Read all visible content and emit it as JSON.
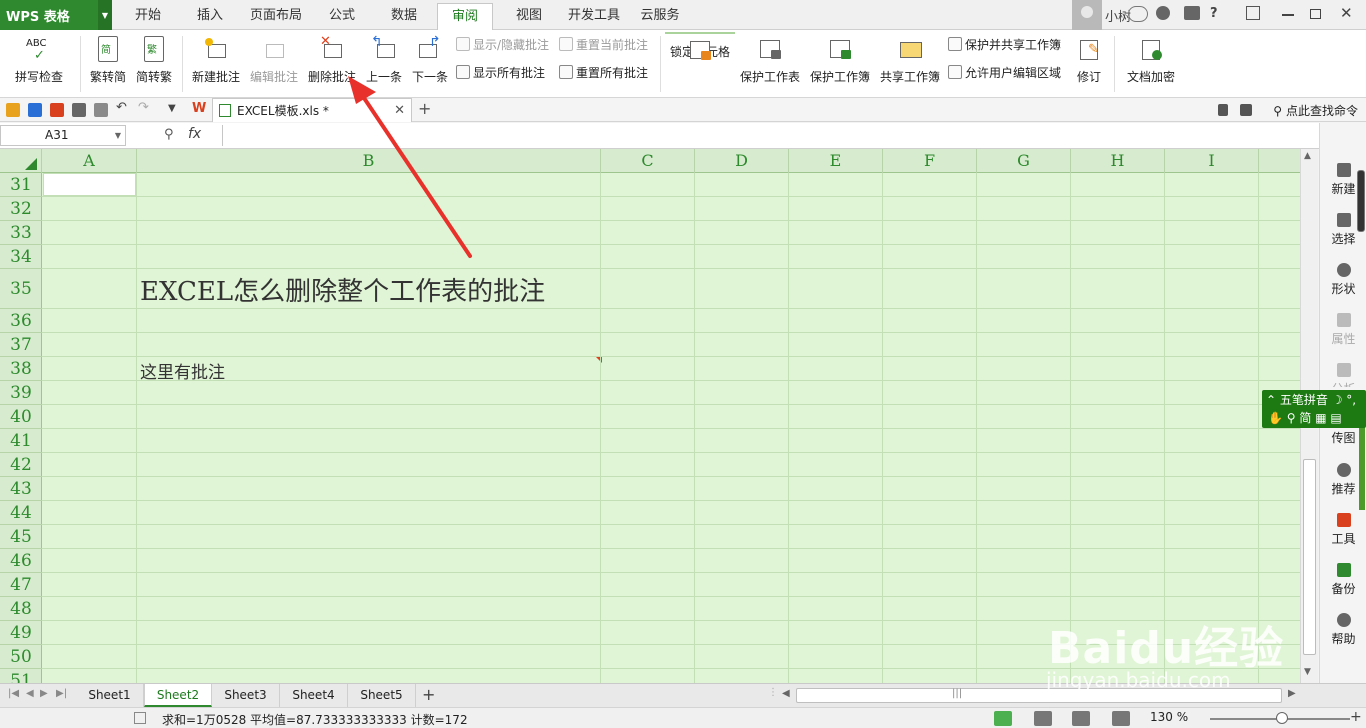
{
  "app": {
    "brand": "WPS 表格"
  },
  "menu_tabs": [
    "开始",
    "插入",
    "页面布局",
    "公式",
    "数据",
    "审阅",
    "视图",
    "开发工具",
    "云服务"
  ],
  "active_menu_tab": "审阅",
  "user": {
    "name": "小树",
    "help": "?"
  },
  "ribbon": {
    "spell_check": "拼写检查",
    "trad_to_simp": "繁转简",
    "simp_to_trad": "简转繁",
    "new_comment": "新建批注",
    "edit_comment": "编辑批注",
    "delete_comment": "删除批注",
    "previous": "上一条",
    "next": "下一条",
    "show_hide_comment": "显示/隐藏批注",
    "reset_current_comment": "重置当前批注",
    "show_all_comments": "显示所有批注",
    "reset_all_comments": "重置所有批注",
    "lock_cell": "锁定单元格",
    "protect_sheet": "保护工作表",
    "protect_workbook": "保护工作簿",
    "share_workbook": "共享工作簿",
    "protect_and_share": "保护并共享工作簿",
    "allow_user_edit": "允许用户编辑区域",
    "track_changes": "修订",
    "doc_encrypt": "文档加密",
    "icon_labels": {
      "abc": "ABC",
      "trad": "繁",
      "simp": "简"
    }
  },
  "document": {
    "tab_title": "EXCEL模板.xls *",
    "find_command": "点此查找命令"
  },
  "formula_bar": {
    "cell_ref": "A31",
    "fx": "fx",
    "value": ""
  },
  "grid": {
    "columns": [
      "A",
      "B",
      "C",
      "D",
      "E",
      "F",
      "G",
      "H",
      "I"
    ],
    "rows": [
      "31",
      "32",
      "33",
      "34",
      "35",
      "36",
      "37",
      "38",
      "39",
      "40",
      "41",
      "42",
      "43",
      "44",
      "45",
      "46",
      "47",
      "48",
      "49",
      "50",
      "51"
    ],
    "b35": "EXCEL怎么删除整个工作表的批注",
    "b38": "这里有批注"
  },
  "sidebar": {
    "items": [
      "新建",
      "选择",
      "形状",
      "属性",
      "分析",
      "传图",
      "推荐",
      "工具",
      "备份",
      "帮助"
    ]
  },
  "ime": {
    "line1": "五笔拼音",
    "line2": "简"
  },
  "sheets": {
    "tabs": [
      "Sheet1",
      "Sheet2",
      "Sheet3",
      "Sheet4",
      "Sheet5"
    ],
    "active": "Sheet2"
  },
  "status": {
    "text": "求和=1万0528  平均值=87.733333333333  计数=172",
    "zoom": "130 %"
  },
  "watermark": {
    "brand": "Baidu经验",
    "url": "jingyan.baidu.com"
  },
  "colors": {
    "brand_green": "#2f8a2f",
    "grid_bg": "#e0f5d5",
    "header_bg": "#d7ebcf",
    "arrow_red": "#e8312a"
  }
}
